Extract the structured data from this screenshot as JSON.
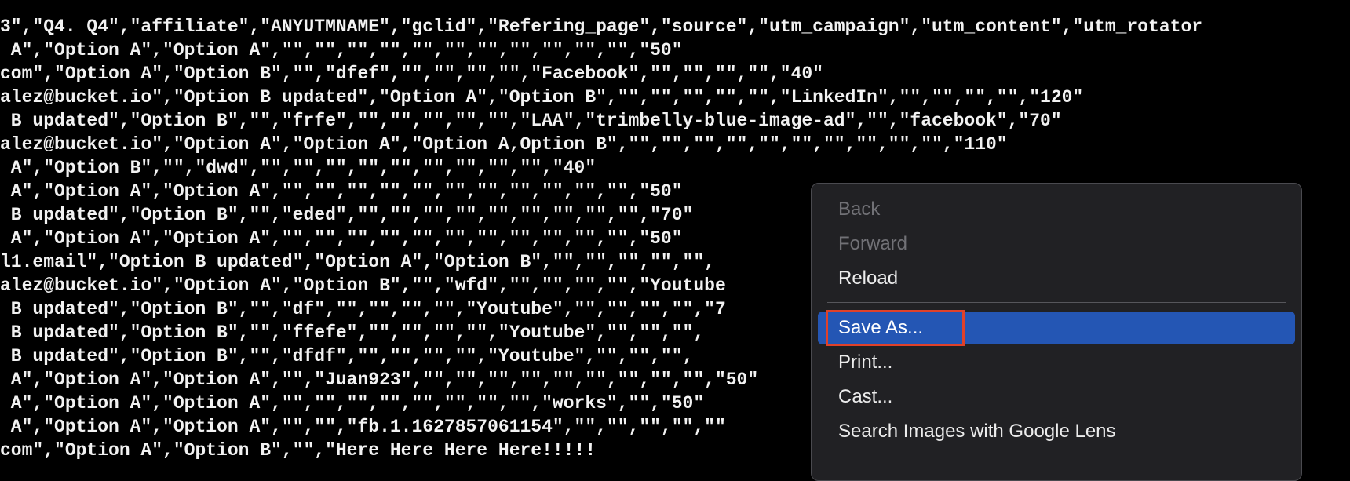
{
  "csv_lines": [
    "3\",\"Q4. Q4\",\"affiliate\",\"ANYUTMNAME\",\"gclid\",\"Refering_page\",\"source\",\"utm_campaign\",\"utm_content\",\"utm_rotator",
    " A\",\"Option A\",\"Option A\",\"\",\"\",\"\",\"\",\"\",\"\",\"\",\"\",\"\",\"\",\"\",\"50\"",
    "com\",\"Option A\",\"Option B\",\"\",\"dfef\",\"\",\"\",\"\",\"\",\"Facebook\",\"\",\"\",\"\",\"\",\"40\"",
    "alez@bucket.io\",\"Option B updated\",\"Option A\",\"Option B\",\"\",\"\",\"\",\"\",\"\",\"LinkedIn\",\"\",\"\",\"\",\"\",\"120\"",
    " B updated\",\"Option B\",\"\",\"frfe\",\"\",\"\",\"\",\"\",\"\",\"LAA\",\"trimbelly-blue-image-ad\",\"\",\"facebook\",\"70\"",
    "alez@bucket.io\",\"Option A\",\"Option A\",\"Option A,Option B\",\"\",\"\",\"\",\"\",\"\",\"\",\"\",\"\",\"\",\"\",\"110\"",
    " A\",\"Option B\",\"\",\"dwd\",\"\",\"\",\"\",\"\",\"\",\"\",\"\",\"\",\"\",\"40\"",
    " A\",\"Option A\",\"Option A\",\"\",\"\",\"\",\"\",\"\",\"\",\"\",\"\",\"\",\"\",\"\",\"50\"",
    " B updated\",\"Option B\",\"\",\"eded\",\"\",\"\",\"\",\"\",\"\",\"\",\"\",\"\",\"\",\"70\"",
    " A\",\"Option A\",\"Option A\",\"\",\"\",\"\",\"\",\"\",\"\",\"\",\"\",\"\",\"\",\"\",\"50\"",
    "l1.email\",\"Option B updated\",\"Option A\",\"Option B\",\"\",\"\",\"\",\"\",\"\",",
    "alez@bucket.io\",\"Option A\",\"Option B\",\"\",\"wfd\",\"\",\"\",\"\",\"\",\"Youtube",
    " B updated\",\"Option B\",\"\",\"df\",\"\",\"\",\"\",\"\",\"Youtube\",\"\",\"\",\"\",\"\",\"7",
    " B updated\",\"Option B\",\"\",\"ffefe\",\"\",\"\",\"\",\"\",\"Youtube\",\"\",\"\",\"\",",
    " B updated\",\"Option B\",\"\",\"dfdf\",\"\",\"\",\"\",\"\",\"Youtube\",\"\",\"\",\"\",",
    " A\",\"Option A\",\"Option A\",\"\",\"Juan923\",\"\",\"\",\"\",\"\",\"\",\"\",\"\",\"\",\"\",\"50\"",
    " A\",\"Option A\",\"Option A\",\"\",\"\",\"\",\"\",\"\",\"\",\"\",\"\",\"works\",\"\",\"50\"",
    " A\",\"Option A\",\"Option A\",\"\",\"\",\"fb.1.1627857061154\",\"\",\"\",\"\",\"\",\"\"",
    "com\",\"Option A\",\"Option B\",\"\",\"Here Here Here Here!!!!!"
  ],
  "context_menu": {
    "back": "Back",
    "forward": "Forward",
    "reload": "Reload",
    "save_as": "Save As...",
    "print": "Print...",
    "cast": "Cast...",
    "search_images": "Search Images with Google Lens"
  },
  "colors": {
    "background": "#000000",
    "text": "#f2f2f2",
    "menu_background": "#212124",
    "highlight": "#2456b4",
    "focus_outline": "#e0412a"
  }
}
